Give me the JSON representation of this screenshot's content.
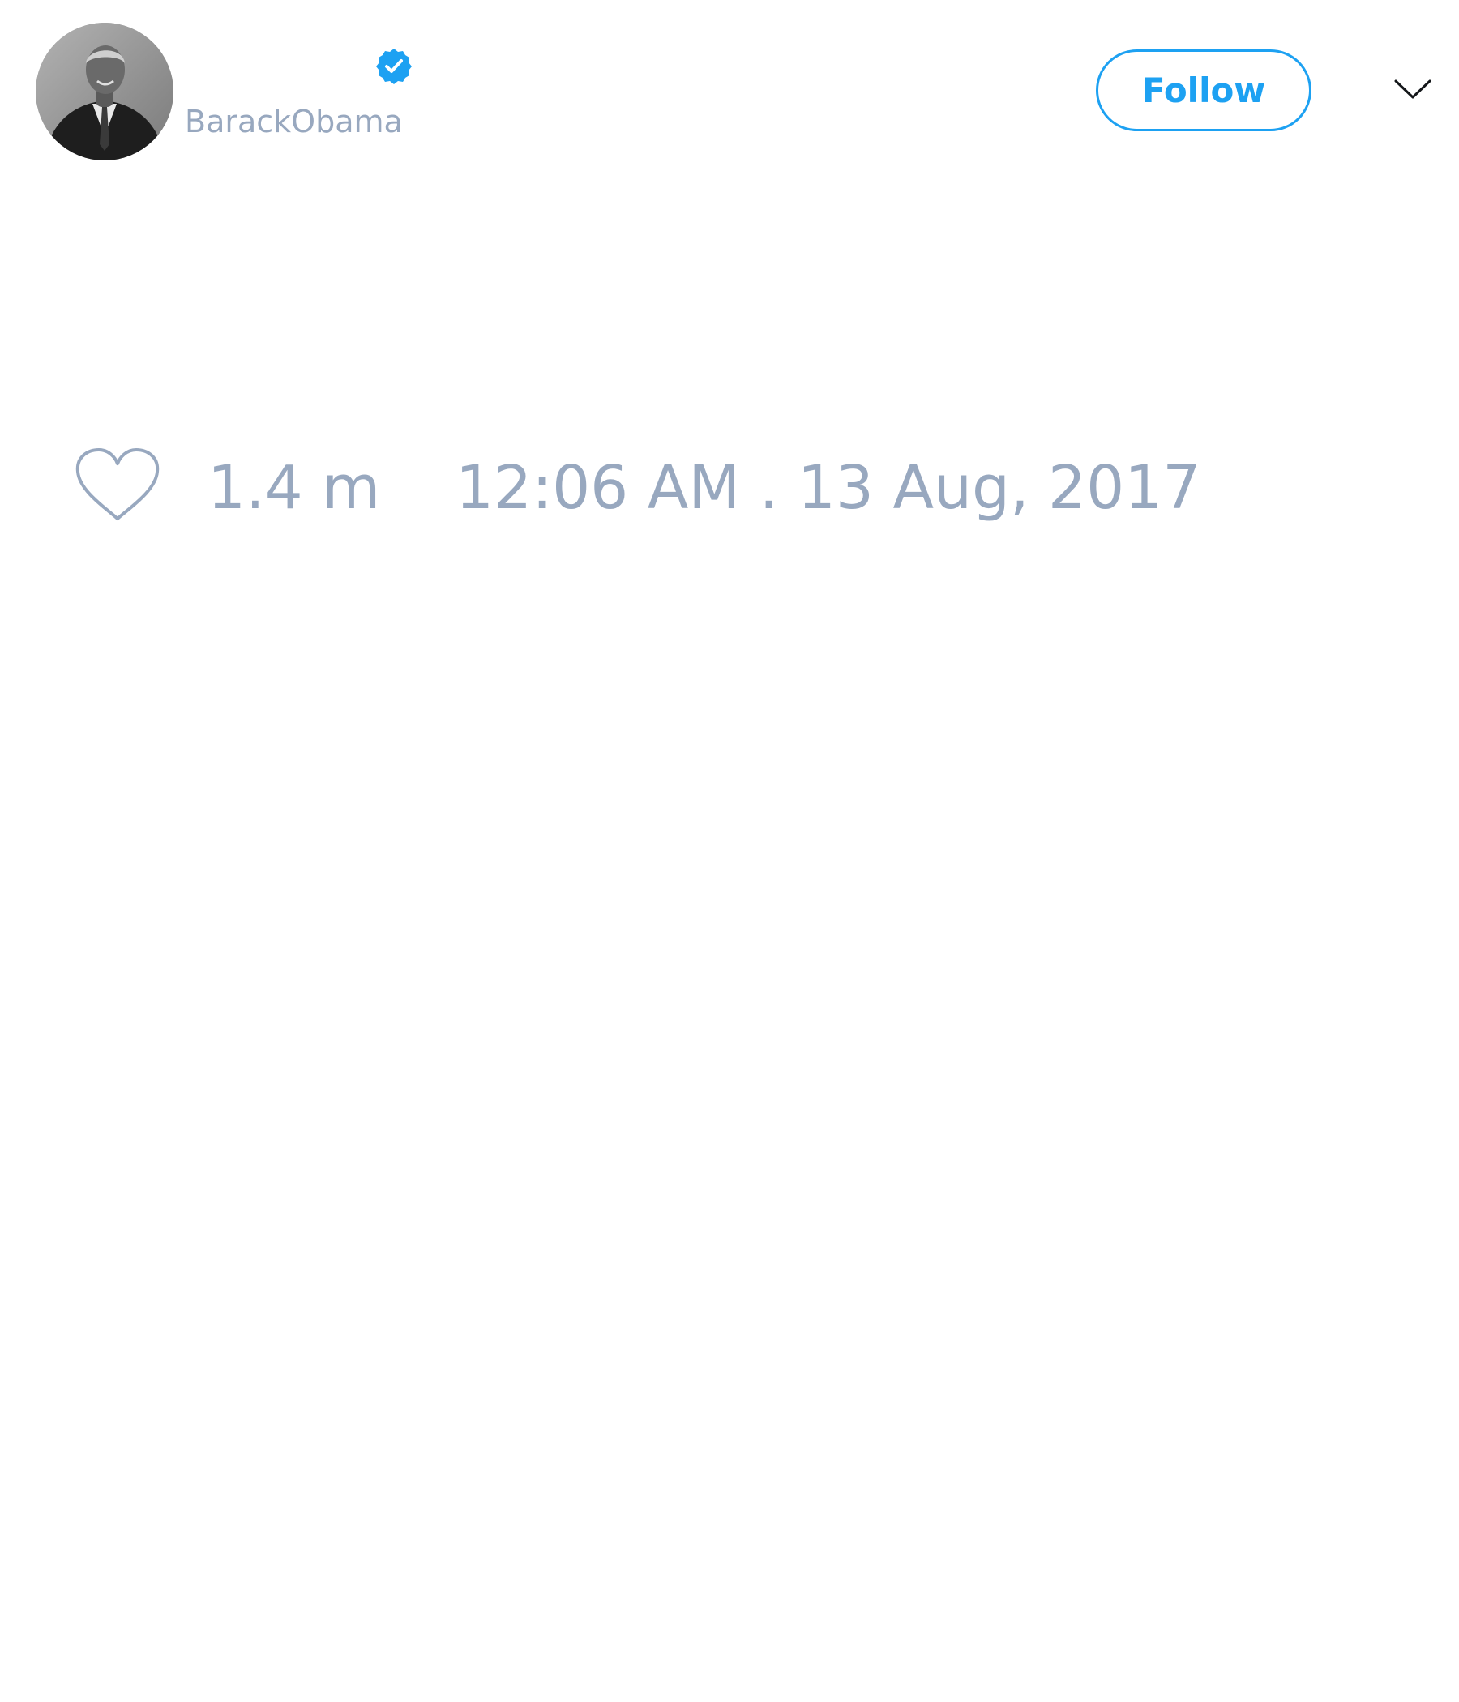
{
  "tweet": {
    "author": {
      "handle": "BarackObama",
      "verified": true,
      "avatar_icon": "profile-photo"
    },
    "follow_button": {
      "label": "Follow"
    },
    "menu_icon": "chevron-down-icon",
    "likes": {
      "icon": "heart-icon",
      "count": "1.4 m"
    },
    "timestamp": "12:06 AM . 13 Aug, 2017"
  },
  "colors": {
    "accent": "#1da1f2",
    "muted_text": "#98a8bf",
    "background": "#ffffff"
  }
}
